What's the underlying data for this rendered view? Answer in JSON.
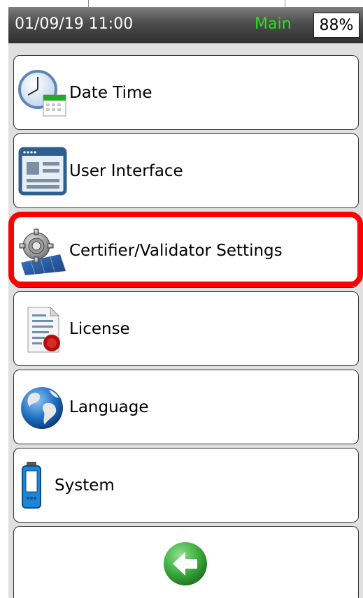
{
  "status_bar": {
    "datetime": "01/09/19 11:00",
    "mode": "Main",
    "battery": "88%",
    "mode_color": "#29e21c"
  },
  "menu": {
    "items": [
      {
        "label": "Date Time",
        "icon": "clock-calendar-icon"
      },
      {
        "label": "User Interface",
        "icon": "window-layout-icon"
      },
      {
        "label": "Certifier/Validator Settings",
        "icon": "gear-settings-icon",
        "highlighted": true
      },
      {
        "label": "License",
        "icon": "certificate-document-icon"
      },
      {
        "label": "Language",
        "icon": "globe-icon"
      },
      {
        "label": "System",
        "icon": "handheld-device-icon"
      }
    ],
    "back_icon": "back-arrow-icon"
  },
  "colors": {
    "highlight": "#ff0000",
    "back_button_green": "#3aa83a",
    "panel_background": "#e0e0e0"
  }
}
